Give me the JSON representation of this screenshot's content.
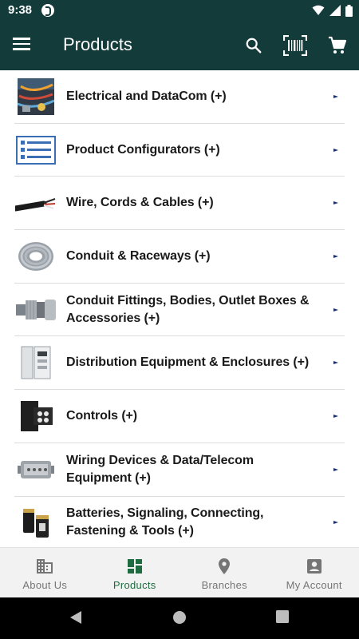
{
  "status_bar": {
    "time": "9:38"
  },
  "app_bar": {
    "title": "Products"
  },
  "products": [
    {
      "label": "Electrical and DataCom (+)",
      "icon": "electrical-datacom-thumbnail"
    },
    {
      "label": "Product Configurators (+)",
      "icon": "configurator-list-icon"
    },
    {
      "label": "Wire, Cords & Cables (+)",
      "icon": "wire-cable-thumbnail"
    },
    {
      "label": "Conduit & Raceways (+)",
      "icon": "conduit-coil-thumbnail"
    },
    {
      "label": "Conduit Fittings, Bodies, Outlet Boxes & Accessories (+)",
      "icon": "conduit-fitting-thumbnail"
    },
    {
      "label": "Distribution Equipment & Enclosures (+)",
      "icon": "distribution-panel-thumbnail"
    },
    {
      "label": "Controls (+)",
      "icon": "contactor-thumbnail"
    },
    {
      "label": "Wiring Devices & Data/Telecom Equipment (+)",
      "icon": "connector-thumbnail"
    },
    {
      "label": "Batteries, Signaling, Connecting, Fastening & Tools (+)",
      "icon": "batteries-thumbnail"
    }
  ],
  "bottom_nav": [
    {
      "label": "About Us",
      "icon": "building-icon"
    },
    {
      "label": "Products",
      "icon": "dashboard-icon",
      "active": true
    },
    {
      "label": "Branches",
      "icon": "location-pin-icon"
    },
    {
      "label": "My Account",
      "icon": "account-box-icon"
    }
  ],
  "colors": {
    "app_bar": "#123b3a",
    "active_nav": "#1e6b3f",
    "arrow": "#1b2f6b"
  }
}
